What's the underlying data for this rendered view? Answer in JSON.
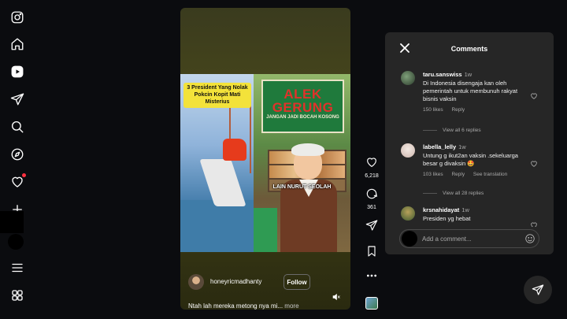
{
  "nav": {
    "items": [
      "instagram-logo",
      "home",
      "reels",
      "messages",
      "search",
      "explore",
      "notifications",
      "create",
      "profile",
      "more",
      "also-from-meta"
    ]
  },
  "reel": {
    "overlay_title": "3 President Yang Nolak Pokcin Kopit Mati Misterius",
    "sign_title": "ALEK GERUNG",
    "sign_subtitle": "JANGAN JADI BOCAH KOSONG",
    "scene_caption": "LAIN NURUT SEOLAH",
    "author": "honeyricmadhanty",
    "follow_label": "Follow",
    "caption": "Ntah lah mereka metong nya mi...",
    "more_label": "more"
  },
  "actions": {
    "likes": "6,218",
    "comments": "361"
  },
  "comments_panel": {
    "title": "Comments",
    "comments": [
      {
        "user": "taru.sanswiss",
        "time": "1w",
        "text": "Di Indonesia disengaja kan oleh pemerintah untuk membunuh rakyat bisnis vaksin",
        "likes": "150 likes",
        "reply": "Reply",
        "view_replies": "View all 6 replies"
      },
      {
        "user": "labella_lelly",
        "time": "1w",
        "text": "Untung g ikut2an vaksin .sekeluarga besar g divaksin 🤩",
        "likes": "103 likes",
        "reply": "Reply",
        "translate": "See translation",
        "view_replies": "View all 28 replies"
      },
      {
        "user": "krsnahidayat",
        "time": "1w",
        "text": "Presiden yg hebat"
      }
    ],
    "input_placeholder": "Add a comment..."
  },
  "colors": {
    "background": "#0b0c0f",
    "panel": "#262626",
    "notification": "#ff3040"
  }
}
